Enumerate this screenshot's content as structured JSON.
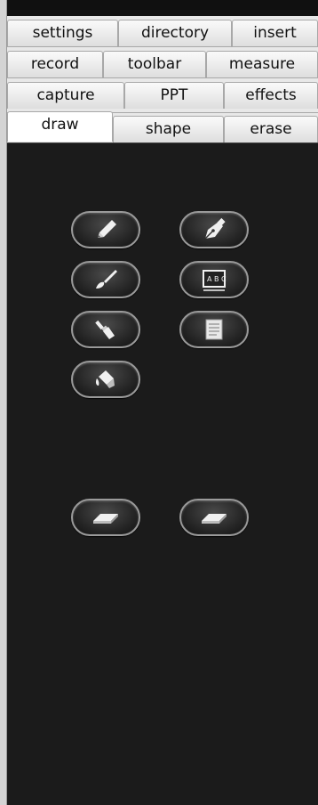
{
  "tabs": {
    "row1": [
      {
        "label": "settings"
      },
      {
        "label": "directory"
      },
      {
        "label": "insert"
      }
    ],
    "row2": [
      {
        "label": "record"
      },
      {
        "label": "toolbar"
      },
      {
        "label": "measure"
      }
    ],
    "row3": [
      {
        "label": "capture"
      },
      {
        "label": "PPT"
      },
      {
        "label": "effects"
      }
    ],
    "row4": [
      {
        "label": "draw"
      },
      {
        "label": "shape"
      },
      {
        "label": "erase"
      }
    ],
    "active_tab": "draw"
  },
  "tools": [
    {
      "icon": "pencil-icon"
    },
    {
      "icon": "pen-icon"
    },
    {
      "icon": "brush-icon"
    },
    {
      "icon": "chalkboard-icon"
    },
    {
      "icon": "paint-brush-icon"
    },
    {
      "icon": "notepad-icon"
    },
    {
      "icon": "paint-bucket-icon"
    },
    {
      "icon": "eraser-icon"
    },
    {
      "icon": "eraser-icon"
    }
  ],
  "colors": {
    "panel_bg": "#1b1b1b",
    "tab_bg": "#e8e8e8",
    "button_border": "#9a9a9a",
    "icon_fill": "#f0f0f0"
  }
}
